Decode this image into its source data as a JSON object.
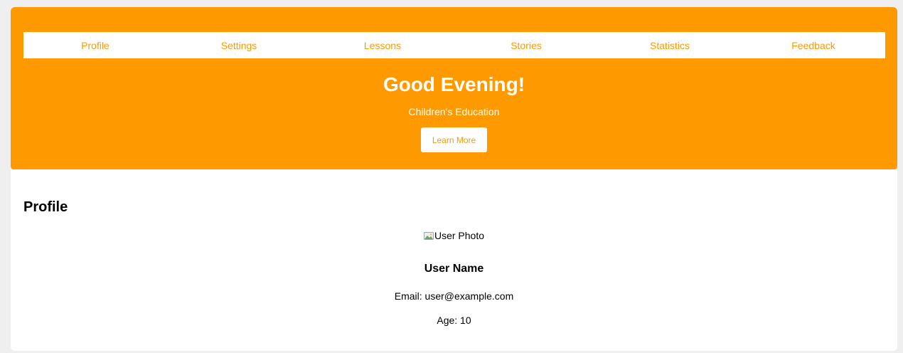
{
  "colors": {
    "accent": "#ff9900",
    "page_background": "#efefef",
    "card_background": "#ffffff",
    "text": "#000000"
  },
  "nav": {
    "items": [
      {
        "label": "Profile"
      },
      {
        "label": "Settings"
      },
      {
        "label": "Lessons"
      },
      {
        "label": "Stories"
      },
      {
        "label": "Statistics"
      },
      {
        "label": "Feedback"
      }
    ]
  },
  "hero": {
    "title": "Good Evening!",
    "subtitle": "Children's Education",
    "button_label": "Learn More"
  },
  "profile": {
    "section_title": "Profile",
    "photo_alt": "User Photo",
    "photo_icon": "broken-image-icon",
    "name": "User Name",
    "email": "Email: user@example.com",
    "age": "Age: 10"
  }
}
